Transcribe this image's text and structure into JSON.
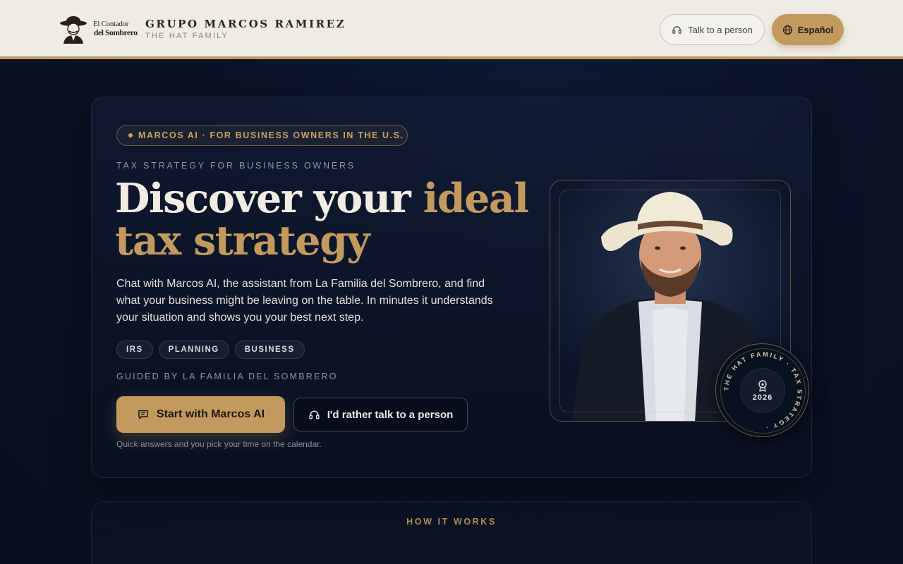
{
  "header": {
    "logo_text_line1": "El Contador",
    "logo_text_line2": "del Sombrero",
    "brand_title": "GRUPO MARCOS RAMIREZ",
    "brand_subtitle": "THE HAT FAMILY",
    "talk_button": "Talk to a person",
    "language_button": "Español"
  },
  "hero": {
    "pill": "MARCOS AI · FOR BUSINESS OWNERS IN THE U.S.",
    "eyebrow": "TAX STRATEGY FOR BUSINESS OWNERS",
    "headline_part1": "Discover your ",
    "headline_gold1": "ideal",
    "headline_gold2": "tax strategy",
    "lead": "Chat with Marcos AI, the assistant from La Familia del Sombrero, and find what your business might be leaving on the table. In minutes it understands your situation and shows you your best next step.",
    "tags": [
      "IRS",
      "PLANNING",
      "BUSINESS"
    ],
    "guided": "GUIDED BY LA FAMILIA DEL SOMBRERO",
    "primary_button": "Start with Marcos AI",
    "secondary_button": "I'd rather talk to a person",
    "footnote": "Quick answers and you pick your time on the calendar.",
    "badge_ring_text": "THE HAT FAMILY · TAX STRATEGY ·",
    "badge_year": "2026"
  },
  "how_it_works": {
    "title": "HOW IT WORKS"
  },
  "colors": {
    "gold": "#c39a5d",
    "navy": "#0a1226",
    "header_bg": "#efece6"
  },
  "icons": {
    "talk": "headset-icon",
    "language": "globe-icon",
    "chat": "chat-icon",
    "award": "award-icon"
  }
}
